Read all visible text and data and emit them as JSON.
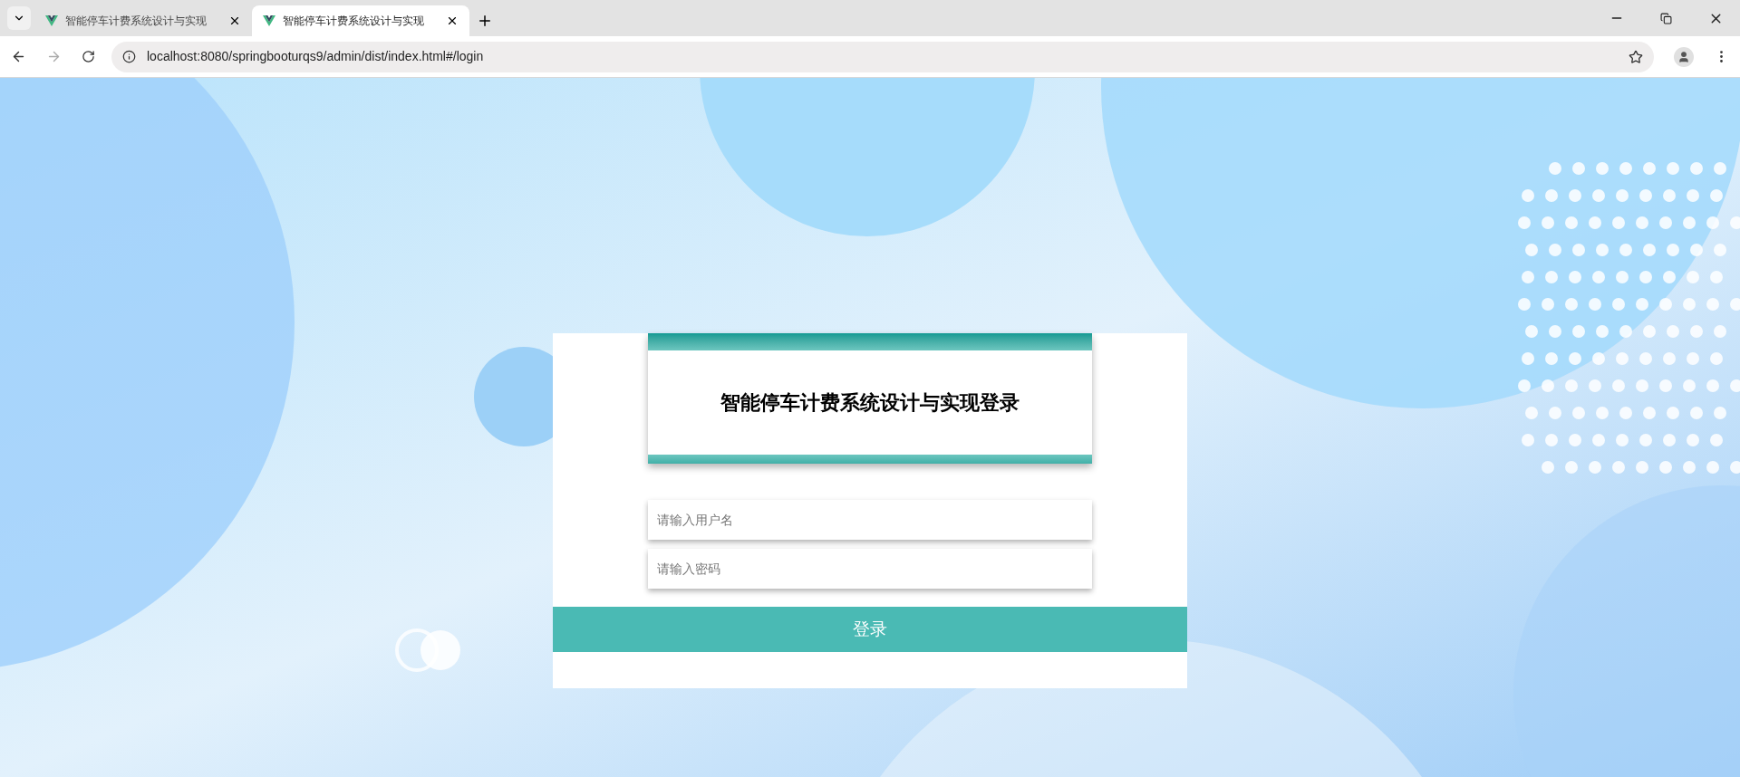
{
  "browser": {
    "tabs": [
      {
        "title": "智能停车计费系统设计与实现",
        "selected": false
      },
      {
        "title": "智能停车计费系统设计与实现",
        "selected": true
      }
    ],
    "url": "localhost:8080/springbooturqs9/admin/dist/index.html#/login"
  },
  "login": {
    "title": "智能停车计费系统设计与实现登录",
    "fields": [
      {
        "placeholder": "请输入用户名"
      },
      {
        "placeholder": "请输入密码"
      }
    ],
    "button": "登录"
  }
}
